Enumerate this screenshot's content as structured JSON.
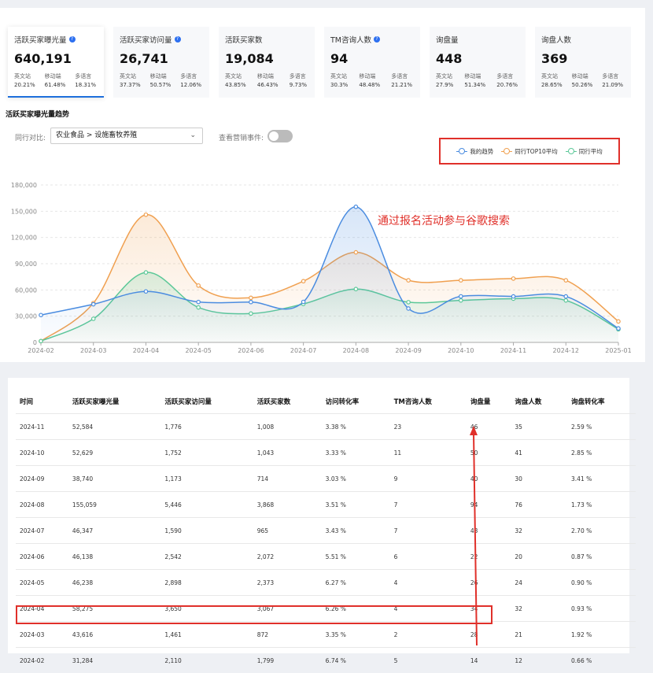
{
  "cards": [
    {
      "title": "活跃买家曝光量",
      "info": true,
      "value": "640,191",
      "subs": [
        {
          "label": "英文站",
          "pct": "20.21%"
        },
        {
          "label": "移动端",
          "pct": "61.48%"
        },
        {
          "label": "多语言",
          "pct": "18.31%"
        }
      ]
    },
    {
      "title": "活跃买家访问量",
      "info": true,
      "value": "26,741",
      "subs": [
        {
          "label": "英文站",
          "pct": "37.37%"
        },
        {
          "label": "移动端",
          "pct": "50.57%"
        },
        {
          "label": "多语言",
          "pct": "12.06%"
        }
      ]
    },
    {
      "title": "活跃买家数",
      "info": false,
      "value": "19,084",
      "subs": [
        {
          "label": "英文站",
          "pct": "43.85%"
        },
        {
          "label": "移动端",
          "pct": "46.43%"
        },
        {
          "label": "多语言",
          "pct": "9.73%"
        }
      ]
    },
    {
      "title": "TM咨询人数",
      "info": true,
      "value": "94",
      "subs": [
        {
          "label": "英文站",
          "pct": "30.3%"
        },
        {
          "label": "移动端",
          "pct": "48.48%"
        },
        {
          "label": "多语言",
          "pct": "21.21%"
        }
      ]
    },
    {
      "title": "询盘量",
      "info": false,
      "value": "448",
      "subs": [
        {
          "label": "英文站",
          "pct": "27.9%"
        },
        {
          "label": "移动端",
          "pct": "51.34%"
        },
        {
          "label": "多语言",
          "pct": "20.76%"
        }
      ]
    },
    {
      "title": "询盘人数",
      "info": false,
      "value": "369",
      "subs": [
        {
          "label": "英文站",
          "pct": "28.65%"
        },
        {
          "label": "移动端",
          "pct": "50.26%"
        },
        {
          "label": "多语言",
          "pct": "21.09%"
        }
      ]
    }
  ],
  "trend": {
    "title": "活跃买家曝光量趋势",
    "peer_label": "同行对比:",
    "peer_value": "农业食品 > 设施畜牧养殖",
    "events_label": "查看营销事件:",
    "events_on": false,
    "annotation": "通过报名活动参与谷歌搜索"
  },
  "chart_data": {
    "type": "line",
    "x": [
      "2024-02",
      "2024-03",
      "2024-04",
      "2024-05",
      "2024-06",
      "2024-07",
      "2024-08",
      "2024-09",
      "2024-10",
      "2024-11",
      "2024-12",
      "2025-01"
    ],
    "yticks": [
      "0",
      "30,000",
      "60,000",
      "90,000",
      "120,000",
      "150,000",
      "180,000"
    ],
    "ylim": [
      0,
      180000
    ],
    "series": [
      {
        "name": "我的趋势",
        "color": "#4a8ce0",
        "values": [
          31284,
          43616,
          58275,
          46238,
          46138,
          46347,
          155059,
          38740,
          52629,
          52584,
          52584,
          16000
        ]
      },
      {
        "name": "同行TOP10平均",
        "color": "#f0a050",
        "values": [
          1500,
          45000,
          146000,
          65000,
          51000,
          70000,
          103000,
          71000,
          71000,
          73000,
          71000,
          24000
        ]
      },
      {
        "name": "同行平均",
        "color": "#5cc898",
        "values": [
          1500,
          27000,
          80000,
          40000,
          33000,
          44000,
          61000,
          46000,
          48000,
          50000,
          48000,
          15000
        ]
      }
    ]
  },
  "table": {
    "headers": [
      "时间",
      "活跃买家曝光量",
      "活跃买家访问量",
      "活跃买家数",
      "访问转化率",
      "TM咨询人数",
      "询盘量",
      "询盘人数",
      "询盘转化率"
    ],
    "rows": [
      [
        "2024-11",
        "52,584",
        "1,776",
        "1,008",
        "3.38 %",
        "23",
        "46",
        "35",
        "2.59 %"
      ],
      [
        "2024-10",
        "52,629",
        "1,752",
        "1,043",
        "3.33 %",
        "11",
        "50",
        "41",
        "2.85 %"
      ],
      [
        "2024-09",
        "38,740",
        "1,173",
        "714",
        "3.03 %",
        "9",
        "40",
        "30",
        "3.41 %"
      ],
      [
        "2024-08",
        "155,059",
        "5,446",
        "3,868",
        "3.51 %",
        "7",
        "94",
        "76",
        "1.73 %"
      ],
      [
        "2024-07",
        "46,347",
        "1,590",
        "965",
        "3.43 %",
        "7",
        "43",
        "32",
        "2.70 %"
      ],
      [
        "2024-06",
        "46,138",
        "2,542",
        "2,072",
        "5.51 %",
        "6",
        "22",
        "20",
        "0.87 %"
      ],
      [
        "2024-05",
        "46,238",
        "2,898",
        "2,373",
        "6.27 %",
        "4",
        "26",
        "24",
        "0.90 %"
      ],
      [
        "2024-04",
        "58,275",
        "3,650",
        "3,067",
        "6.26 %",
        "4",
        "34",
        "32",
        "0.93 %"
      ],
      [
        "2024-03",
        "43,616",
        "1,461",
        "872",
        "3.35 %",
        "2",
        "28",
        "21",
        "1.92 %"
      ],
      [
        "2024-02",
        "31,284",
        "2,110",
        "1,799",
        "6.74 %",
        "5",
        "14",
        "12",
        "0.66 %"
      ]
    ]
  }
}
